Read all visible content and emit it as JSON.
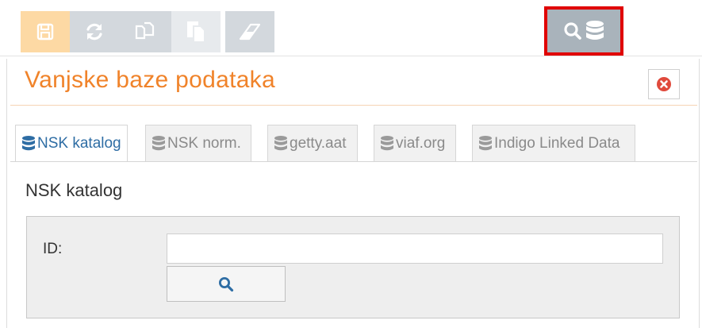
{
  "toolbar": {
    "buttons": [
      {
        "name": "save",
        "icon": "floppy-disk-icon"
      },
      {
        "name": "refresh",
        "icon": "refresh-icon"
      },
      {
        "name": "copy",
        "icon": "copy-icon"
      },
      {
        "name": "paste",
        "icon": "paste-icon"
      },
      {
        "name": "erase",
        "icon": "eraser-icon"
      },
      {
        "name": "search-database",
        "icon": "search-database-icon"
      }
    ]
  },
  "panel": {
    "title": "Vanjske baze podataka",
    "close_icon": "close-icon"
  },
  "tabs": [
    {
      "label": "NSK katalog",
      "active": true
    },
    {
      "label": "NSK norm.",
      "active": false
    },
    {
      "label": "getty.aat",
      "active": false
    },
    {
      "label": "viaf.org",
      "active": false
    },
    {
      "label": "Indigo Linked Data",
      "active": false
    }
  ],
  "section": {
    "title": "NSK katalog"
  },
  "form": {
    "id_label": "ID:",
    "id_value": "",
    "id_placeholder": ""
  },
  "colors": {
    "accent": "#f0832a",
    "tab_active": "#2e6da4",
    "highlight_border": "#e00000"
  }
}
